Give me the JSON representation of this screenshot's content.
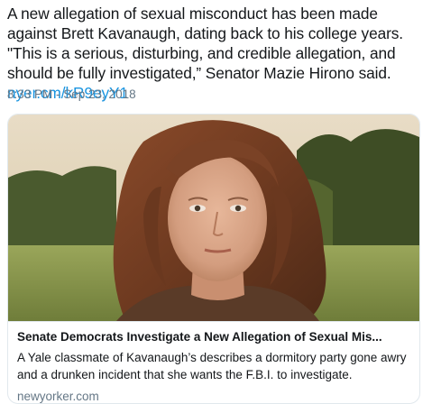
{
  "tweet": {
    "text": "A new allegation of sexual misconduct has been made against Brett Kavanaugh, dating back to his college years. \"This is a serious, disturbing, and credible allegation, and should be fully investigated,” Senator Mazie Hirono said. ",
    "link": "nyer.cm/kR9eyY1",
    "timestamp": "8:33 PM - Sep 23, 2018"
  },
  "card": {
    "title": "Senate Democrats Investigate a New Allegation of Sexual Mis...",
    "description": "A Yale classmate of Kavanaugh’s describes a dormitory party gone awry and a drunken incident that she wants the F.B.I. to investigate.",
    "domain": "newyorker.com"
  },
  "colors": {
    "link": "#1b95e0",
    "muted": "#657786",
    "border": "#e1e8ed"
  }
}
